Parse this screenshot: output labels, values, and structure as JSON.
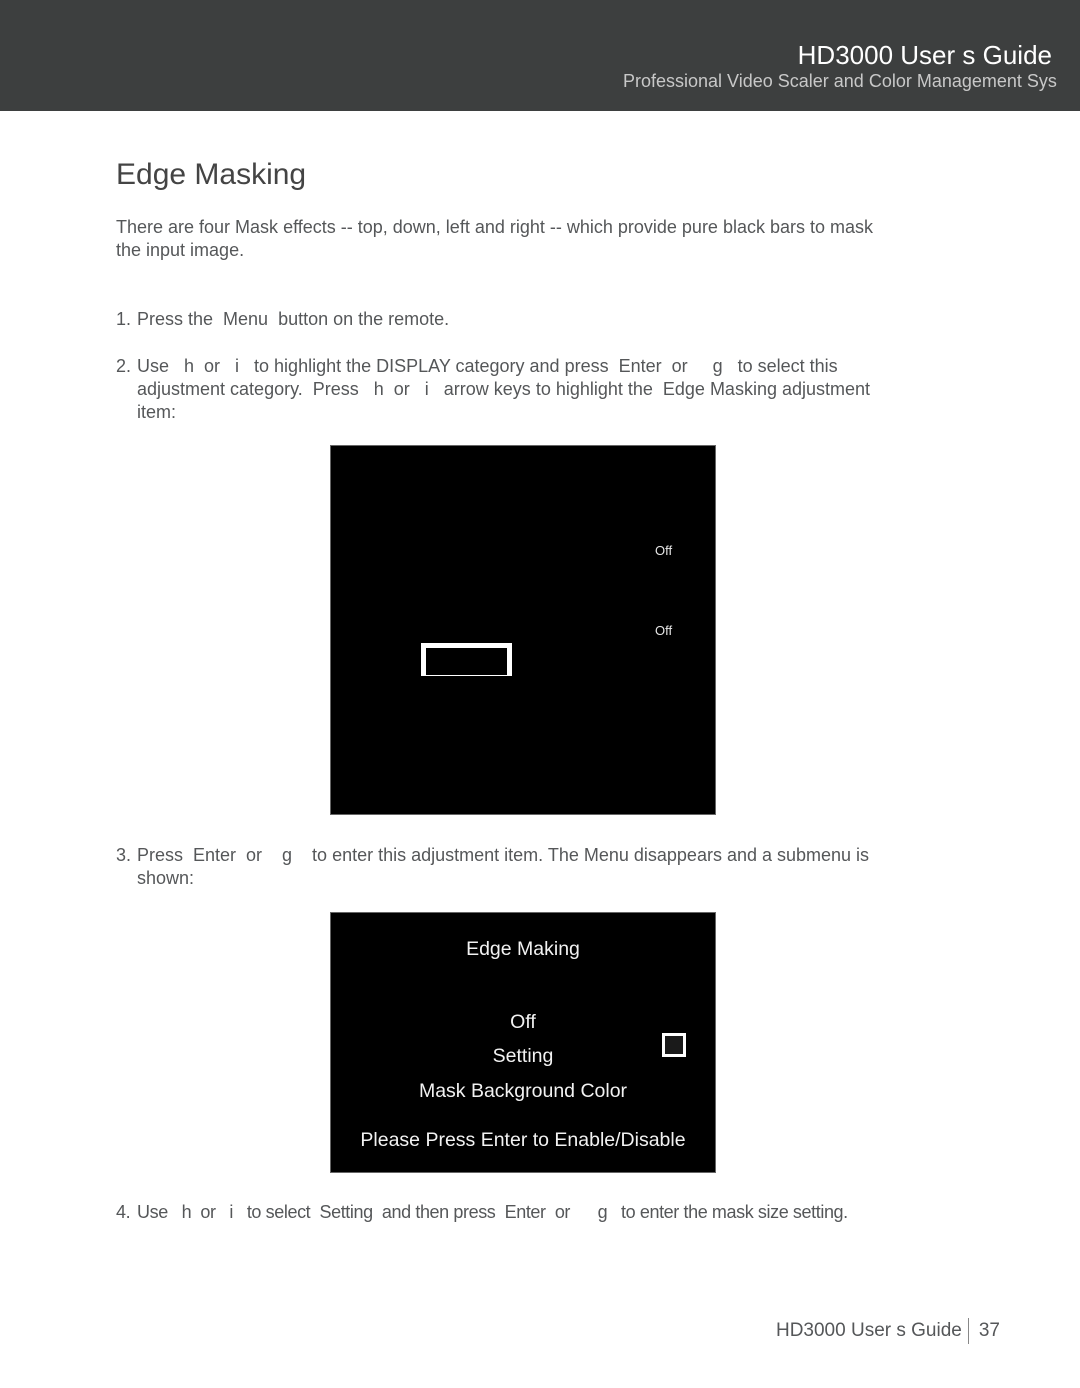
{
  "header": {
    "title": "HD3000 User s Guide",
    "subtitle": "Professional Video Scaler and Color Management Sys"
  },
  "page_title": "Edge Masking",
  "intro": "There are four Mask effects -- top, down, left and right -- which provide pure black bars to mask the input image.",
  "steps": [
    {
      "num": "1.",
      "text": "Press the  Menu  button on the remote."
    },
    {
      "num": "2.",
      "text": "Use   h  or   i   to highlight the DISPLAY category and press  Enter  or     g   to select this adjustment category.  Press   h  or   i   arrow keys to highlight the  Edge Masking adjustment item:"
    },
    {
      "num": "3.",
      "text": "Press  Enter  or    g    to enter this adjustment item. The Menu disappears and a submenu is shown:"
    },
    {
      "num": "4.",
      "text": "Use   h  or   i   to select  Setting  and then press  Enter  or      g   to enter the mask size setting."
    }
  ],
  "screen1": {
    "values": [
      "Off",
      "Off"
    ]
  },
  "screen2": {
    "title": "Edge Making",
    "items": [
      "Off",
      "Setting",
      "Mask Background Color"
    ],
    "hint": "Please Press Enter to Enable/Disable",
    "swatch_color": "#1a1a1a"
  },
  "footer": {
    "label": "HD3000 User s Guide",
    "page_number": "37"
  }
}
